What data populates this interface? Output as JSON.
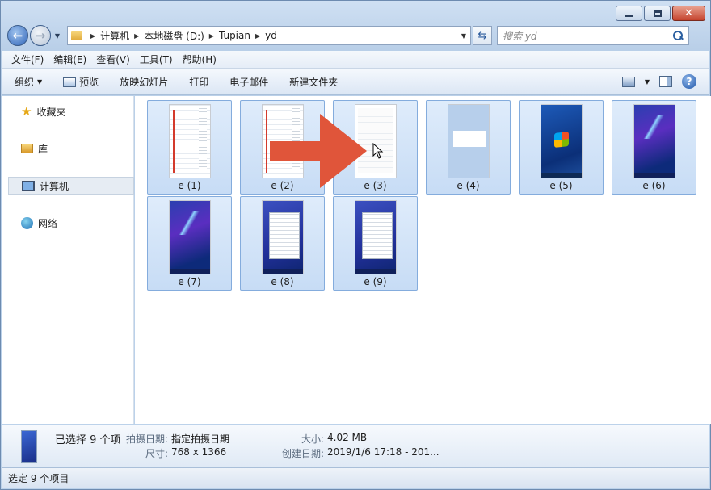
{
  "window": {
    "caption_buttons": {
      "minimize": "–",
      "maximize": "□",
      "close": "✕"
    }
  },
  "address_bar": {
    "crumbs": [
      "计算机",
      "本地磁盘 (D:)",
      "Tupian",
      "yd"
    ]
  },
  "search": {
    "placeholder": "搜索 yd"
  },
  "menu": [
    "文件(F)",
    "编辑(E)",
    "查看(V)",
    "工具(T)",
    "帮助(H)"
  ],
  "toolbar": {
    "organize": "组织",
    "preview": "预览",
    "slideshow": "放映幻灯片",
    "print": "打印",
    "email": "电子邮件",
    "new_folder": "新建文件夹"
  },
  "nav_pane": {
    "favorites": "收藏夹",
    "libraries": "库",
    "computer": "计算机",
    "network": "网络"
  },
  "files": [
    {
      "name": "e (1)",
      "thumb": "doc"
    },
    {
      "name": "e (2)",
      "thumb": "doc"
    },
    {
      "name": "e (3)",
      "thumb": "plain"
    },
    {
      "name": "e (4)",
      "thumb": "lightblue"
    },
    {
      "name": "e (5)",
      "thumb": "win"
    },
    {
      "name": "e (6)",
      "thumb": "purple"
    },
    {
      "name": "e (7)",
      "thumb": "purple"
    },
    {
      "name": "e (8)",
      "thumb": "overlay"
    },
    {
      "name": "e (9)",
      "thumb": "overlay"
    }
  ],
  "details": {
    "selected": "已选择 9 个项",
    "date_taken_key": "拍摄日期:",
    "date_taken_val": "指定拍摄日期",
    "dimensions_key": "尺寸:",
    "dimensions_val": "768 x 1366",
    "size_key": "大小:",
    "size_val": "4.02 MB",
    "created_key": "创建日期:",
    "created_val": "2019/1/6 17:18 - 201..."
  },
  "status": {
    "text": "选定 9 个项目"
  },
  "colors": {
    "arrow": "#e0553a",
    "selection_fill": "#cde0f7",
    "selection_border": "#84acdd"
  }
}
